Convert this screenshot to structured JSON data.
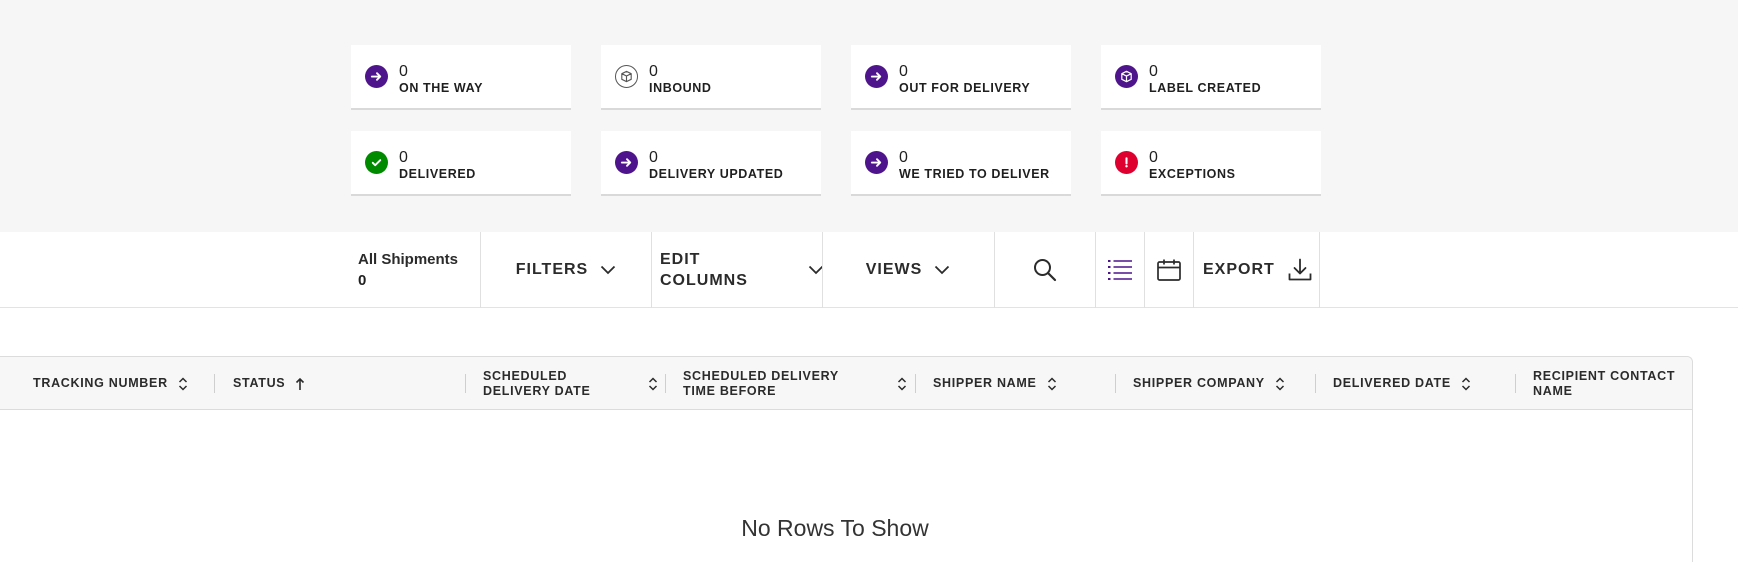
{
  "summary_cards": [
    {
      "count": "0",
      "label": "ON THE WAY",
      "icon": "arrow-right-icon",
      "color": "#4d148c"
    },
    {
      "count": "0",
      "label": "INBOUND",
      "icon": "package-icon",
      "color": "#555555"
    },
    {
      "count": "0",
      "label": "OUT FOR DELIVERY",
      "icon": "arrow-right-icon",
      "color": "#4d148c"
    },
    {
      "count": "0",
      "label": "LABEL CREATED",
      "icon": "package-icon",
      "color": "#4d148c"
    },
    {
      "count": "0",
      "label": "DELIVERED",
      "icon": "check-icon",
      "color": "#008a00"
    },
    {
      "count": "0",
      "label": "DELIVERY UPDATED",
      "icon": "arrow-right-icon",
      "color": "#4d148c"
    },
    {
      "count": "0",
      "label": "WE TRIED TO DELIVER",
      "icon": "arrow-right-icon",
      "color": "#4d148c"
    },
    {
      "count": "0",
      "label": "EXCEPTIONS",
      "icon": "exclamation-icon",
      "color": "#de002e"
    }
  ],
  "toolbar": {
    "all_shipments_label": "All Shipments",
    "all_shipments_count": "0",
    "filters_label": "FILTERS",
    "edit_columns_line1": "EDIT",
    "edit_columns_line2": "COLUMNS",
    "views_label": "VIEWS",
    "export_label": "EXPORT"
  },
  "grid": {
    "columns": [
      {
        "line1": "TRACKING NUMBER",
        "line2": "",
        "sort": "both"
      },
      {
        "line1": "STATUS",
        "line2": "",
        "sort": "asc"
      },
      {
        "line1": "SCHEDULED",
        "line2": "DELIVERY DATE",
        "sort": "both"
      },
      {
        "line1": "SCHEDULED DELIVERY",
        "line2": "TIME BEFORE",
        "sort": "both"
      },
      {
        "line1": "SHIPPER NAME",
        "line2": "",
        "sort": "both"
      },
      {
        "line1": "SHIPPER COMPANY",
        "line2": "",
        "sort": "both"
      },
      {
        "line1": "DELIVERED DATE",
        "line2": "",
        "sort": "both"
      },
      {
        "line1": "RECIPIENT CONTACT",
        "line2": "NAME",
        "sort": "both"
      }
    ],
    "empty_message": "No Rows To Show"
  },
  "colors": {
    "brand_purple": "#4d148c",
    "success_green": "#008a00",
    "exception_red": "#de002e"
  }
}
